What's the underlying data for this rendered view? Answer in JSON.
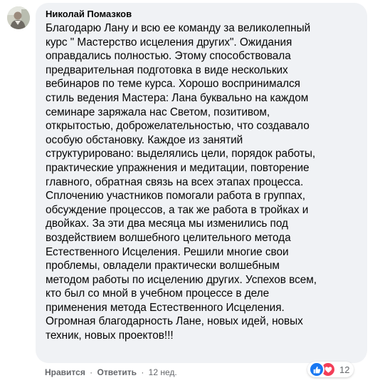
{
  "comment": {
    "author": "Николай Помазков",
    "text": "Благодарю Лану и всю ее команду за великолепный\nкурс \" Мастерство исцеления других\". Ожидания\nоправдались полностью. Этому способствовала\nпредварительная подготовка в виде нескольких\nвебинаров по теме курса. Хорошо воспринимался\nстиль ведения Мастера: Лана буквально на каждом\nсеминаре заряжала нас Светом, позитивом,\nоткрытостью, доброжелательностью, что создавало\nособую обстановку. Каждое из занятий\nструктурировано: выделялись цели, порядок работы,\nпрактические упражнения и медитации, повторение\nглавного, обратная связь на всех этапах процесса.\nСплочению участников помогали работа в группах,\nобсуждение процессов, а так же работа в тройках и\nдвойках. За эти два месяца мы изменились под\nвоздействием волшебного целительного метода\nЕстественного Исцеления. Решили многие свои\nпроблемы, овладели практически волшебным\nметодом работы по исцелению других. Успехов всем,\nкто был со мной в учебном процессе в деле\nприменения метода Естественного Исцеления.\nОгромная благодарность Лане, новых идей, новых\nтехник, новых проектов!!!",
    "like_label": "Нравится",
    "reply_label": "Ответить",
    "separator": "·",
    "time": "12 нед.",
    "reaction_count": "12",
    "reaction_icons": [
      "like-icon",
      "love-icon"
    ]
  },
  "colors": {
    "bubble_bg": "#f0f2f5",
    "text": "#050505",
    "secondary_text": "#65676b",
    "like_blue": "#1877f2",
    "love_red": "#f33e58"
  }
}
